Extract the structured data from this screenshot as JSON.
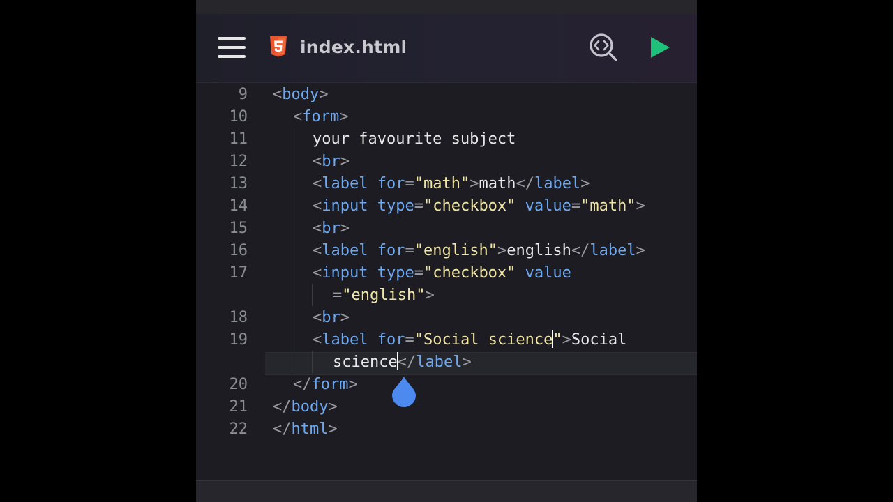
{
  "header": {
    "file_name": "index.html",
    "icons": {
      "menu": "hamburger-menu-icon",
      "file_type": "html5-icon",
      "code_search": "code-search-icon",
      "run": "play-icon"
    }
  },
  "colors": {
    "background": "#1c1c22",
    "tag": "#6ea8f0",
    "attribute": "#6ea8f0",
    "string": "#f2e6a6",
    "punctuation": "#9a9aa3",
    "text": "#e8e8e8",
    "line_number": "#8b8b93",
    "html5_badge": "#e8552f",
    "run_button": "#1fc17a",
    "cursor_handle": "#4d8af0"
  },
  "editor": {
    "gutter": [
      "9",
      "10",
      "11",
      "12",
      "13",
      "14",
      "15",
      "16",
      "17",
      "",
      "18",
      "19",
      "",
      "20",
      "21",
      "22"
    ],
    "lines": [
      [
        {
          "t": "<",
          "c": "punct"
        },
        {
          "t": "body",
          "c": "tag"
        },
        {
          "t": ">",
          "c": "punct"
        }
      ],
      [
        {
          "t": "<",
          "c": "punct"
        },
        {
          "t": "form",
          "c": "tag"
        },
        {
          "t": ">",
          "c": "punct"
        }
      ],
      [
        {
          "t": "your favourite subject",
          "c": "text"
        }
      ],
      [
        {
          "t": "<",
          "c": "punct"
        },
        {
          "t": "br",
          "c": "tag"
        },
        {
          "t": ">",
          "c": "punct"
        }
      ],
      [
        {
          "t": "<",
          "c": "punct"
        },
        {
          "t": "label",
          "c": "tag"
        },
        {
          "t": " ",
          "c": "text"
        },
        {
          "t": "for",
          "c": "attr"
        },
        {
          "t": "=",
          "c": "punct"
        },
        {
          "t": "\"math\"",
          "c": "str"
        },
        {
          "t": ">",
          "c": "punct"
        },
        {
          "t": "math",
          "c": "text"
        },
        {
          "t": "</",
          "c": "punct"
        },
        {
          "t": "label",
          "c": "tag"
        },
        {
          "t": ">",
          "c": "punct"
        }
      ],
      [
        {
          "t": "<",
          "c": "punct"
        },
        {
          "t": "input",
          "c": "tag"
        },
        {
          "t": " ",
          "c": "text"
        },
        {
          "t": "type",
          "c": "attr"
        },
        {
          "t": "=",
          "c": "punct"
        },
        {
          "t": "\"checkbox\"",
          "c": "str"
        },
        {
          "t": " ",
          "c": "text"
        },
        {
          "t": "value",
          "c": "attr"
        },
        {
          "t": "=",
          "c": "punct"
        },
        {
          "t": "\"math\"",
          "c": "str"
        },
        {
          "t": ">",
          "c": "punct"
        }
      ],
      [
        {
          "t": "<",
          "c": "punct"
        },
        {
          "t": "br",
          "c": "tag"
        },
        {
          "t": ">",
          "c": "punct"
        }
      ],
      [
        {
          "t": "<",
          "c": "punct"
        },
        {
          "t": "label",
          "c": "tag"
        },
        {
          "t": " ",
          "c": "text"
        },
        {
          "t": "for",
          "c": "attr"
        },
        {
          "t": "=",
          "c": "punct"
        },
        {
          "t": "\"english\"",
          "c": "str"
        },
        {
          "t": ">",
          "c": "punct"
        },
        {
          "t": "english",
          "c": "text"
        },
        {
          "t": "</",
          "c": "punct"
        },
        {
          "t": "label",
          "c": "tag"
        },
        {
          "t": ">",
          "c": "punct"
        }
      ],
      [
        {
          "t": "<",
          "c": "punct"
        },
        {
          "t": "input",
          "c": "tag"
        },
        {
          "t": " ",
          "c": "text"
        },
        {
          "t": "type",
          "c": "attr"
        },
        {
          "t": "=",
          "c": "punct"
        },
        {
          "t": "\"checkbox\"",
          "c": "str"
        },
        {
          "t": " ",
          "c": "text"
        },
        {
          "t": "value",
          "c": "attr"
        }
      ],
      [
        {
          "t": "=",
          "c": "punct"
        },
        {
          "t": "\"english\"",
          "c": "str"
        },
        {
          "t": ">",
          "c": "punct"
        }
      ],
      [
        {
          "t": "<",
          "c": "punct"
        },
        {
          "t": "br",
          "c": "tag"
        },
        {
          "t": ">",
          "c": "punct"
        }
      ],
      [
        {
          "t": "<",
          "c": "punct"
        },
        {
          "t": "label",
          "c": "tag"
        },
        {
          "t": " ",
          "c": "text"
        },
        {
          "t": "for",
          "c": "attr"
        },
        {
          "t": "=",
          "c": "punct"
        },
        {
          "t": "\"Social science",
          "c": "str"
        },
        {
          "t": "",
          "c": "caret"
        },
        {
          "t": "\"",
          "c": "str"
        },
        {
          "t": ">",
          "c": "punct"
        },
        {
          "t": "Social",
          "c": "text"
        }
      ],
      [
        {
          "t": "science",
          "c": "text"
        },
        {
          "t": "",
          "c": "caret"
        },
        {
          "t": "</",
          "c": "punct"
        },
        {
          "t": "label",
          "c": "tag"
        },
        {
          "t": ">",
          "c": "punct"
        }
      ],
      [
        {
          "t": "</",
          "c": "punct"
        },
        {
          "t": "form",
          "c": "tag"
        },
        {
          "t": ">",
          "c": "punct"
        }
      ],
      [
        {
          "t": "</",
          "c": "punct"
        },
        {
          "t": "body",
          "c": "tag"
        },
        {
          "t": ">",
          "c": "punct"
        }
      ],
      [
        {
          "t": "</",
          "c": "punct"
        },
        {
          "t": "html",
          "c": "tag"
        },
        {
          "t": ">",
          "c": "punct"
        }
      ]
    ]
  }
}
